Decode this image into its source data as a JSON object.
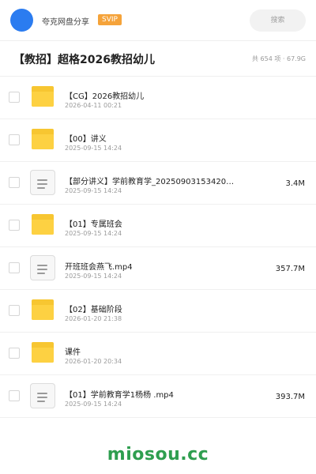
{
  "header": {
    "username": "夸克网盘分享",
    "badge": "SVIP",
    "search_placeholder": "搜索"
  },
  "folder": {
    "title": "【教招】超格2026教招幼儿",
    "meta": "共 654 项 · 67.9G"
  },
  "files": [
    {
      "type": "folder",
      "name": "【CG】2026教招幼儿",
      "date": "2026-04-11 00:21",
      "size": ""
    },
    {
      "type": "folder",
      "name": "【00】讲义",
      "date": "2025-09-15 14:24",
      "size": ""
    },
    {
      "type": "doc",
      "name": "【部分讲义】学前教育学_20250903153420…",
      "date": "2025-09-15 14:24",
      "size": "3.4M"
    },
    {
      "type": "folder",
      "name": "【01】专属班会",
      "date": "2025-09-15 14:24",
      "size": ""
    },
    {
      "type": "doc",
      "name": "开班班会燕飞.mp4",
      "date": "2025-09-15 14:24",
      "size": "357.7M"
    },
    {
      "type": "folder",
      "name": "【02】基础阶段",
      "date": "2026-01-20 21:38",
      "size": ""
    },
    {
      "type": "folder",
      "name": "课件",
      "date": "2026-01-20 20:34",
      "size": ""
    },
    {
      "type": "doc",
      "name": "【01】学前教育学1杨杨 .mp4",
      "date": "2025-09-15 14:24",
      "size": "393.7M"
    }
  ],
  "watermark": "miosou.cc",
  "colors": {
    "accent": "#2b7cf0",
    "badge": "#f5a33a",
    "folder": "#fdd142",
    "watermark": "#2e9e4f"
  }
}
